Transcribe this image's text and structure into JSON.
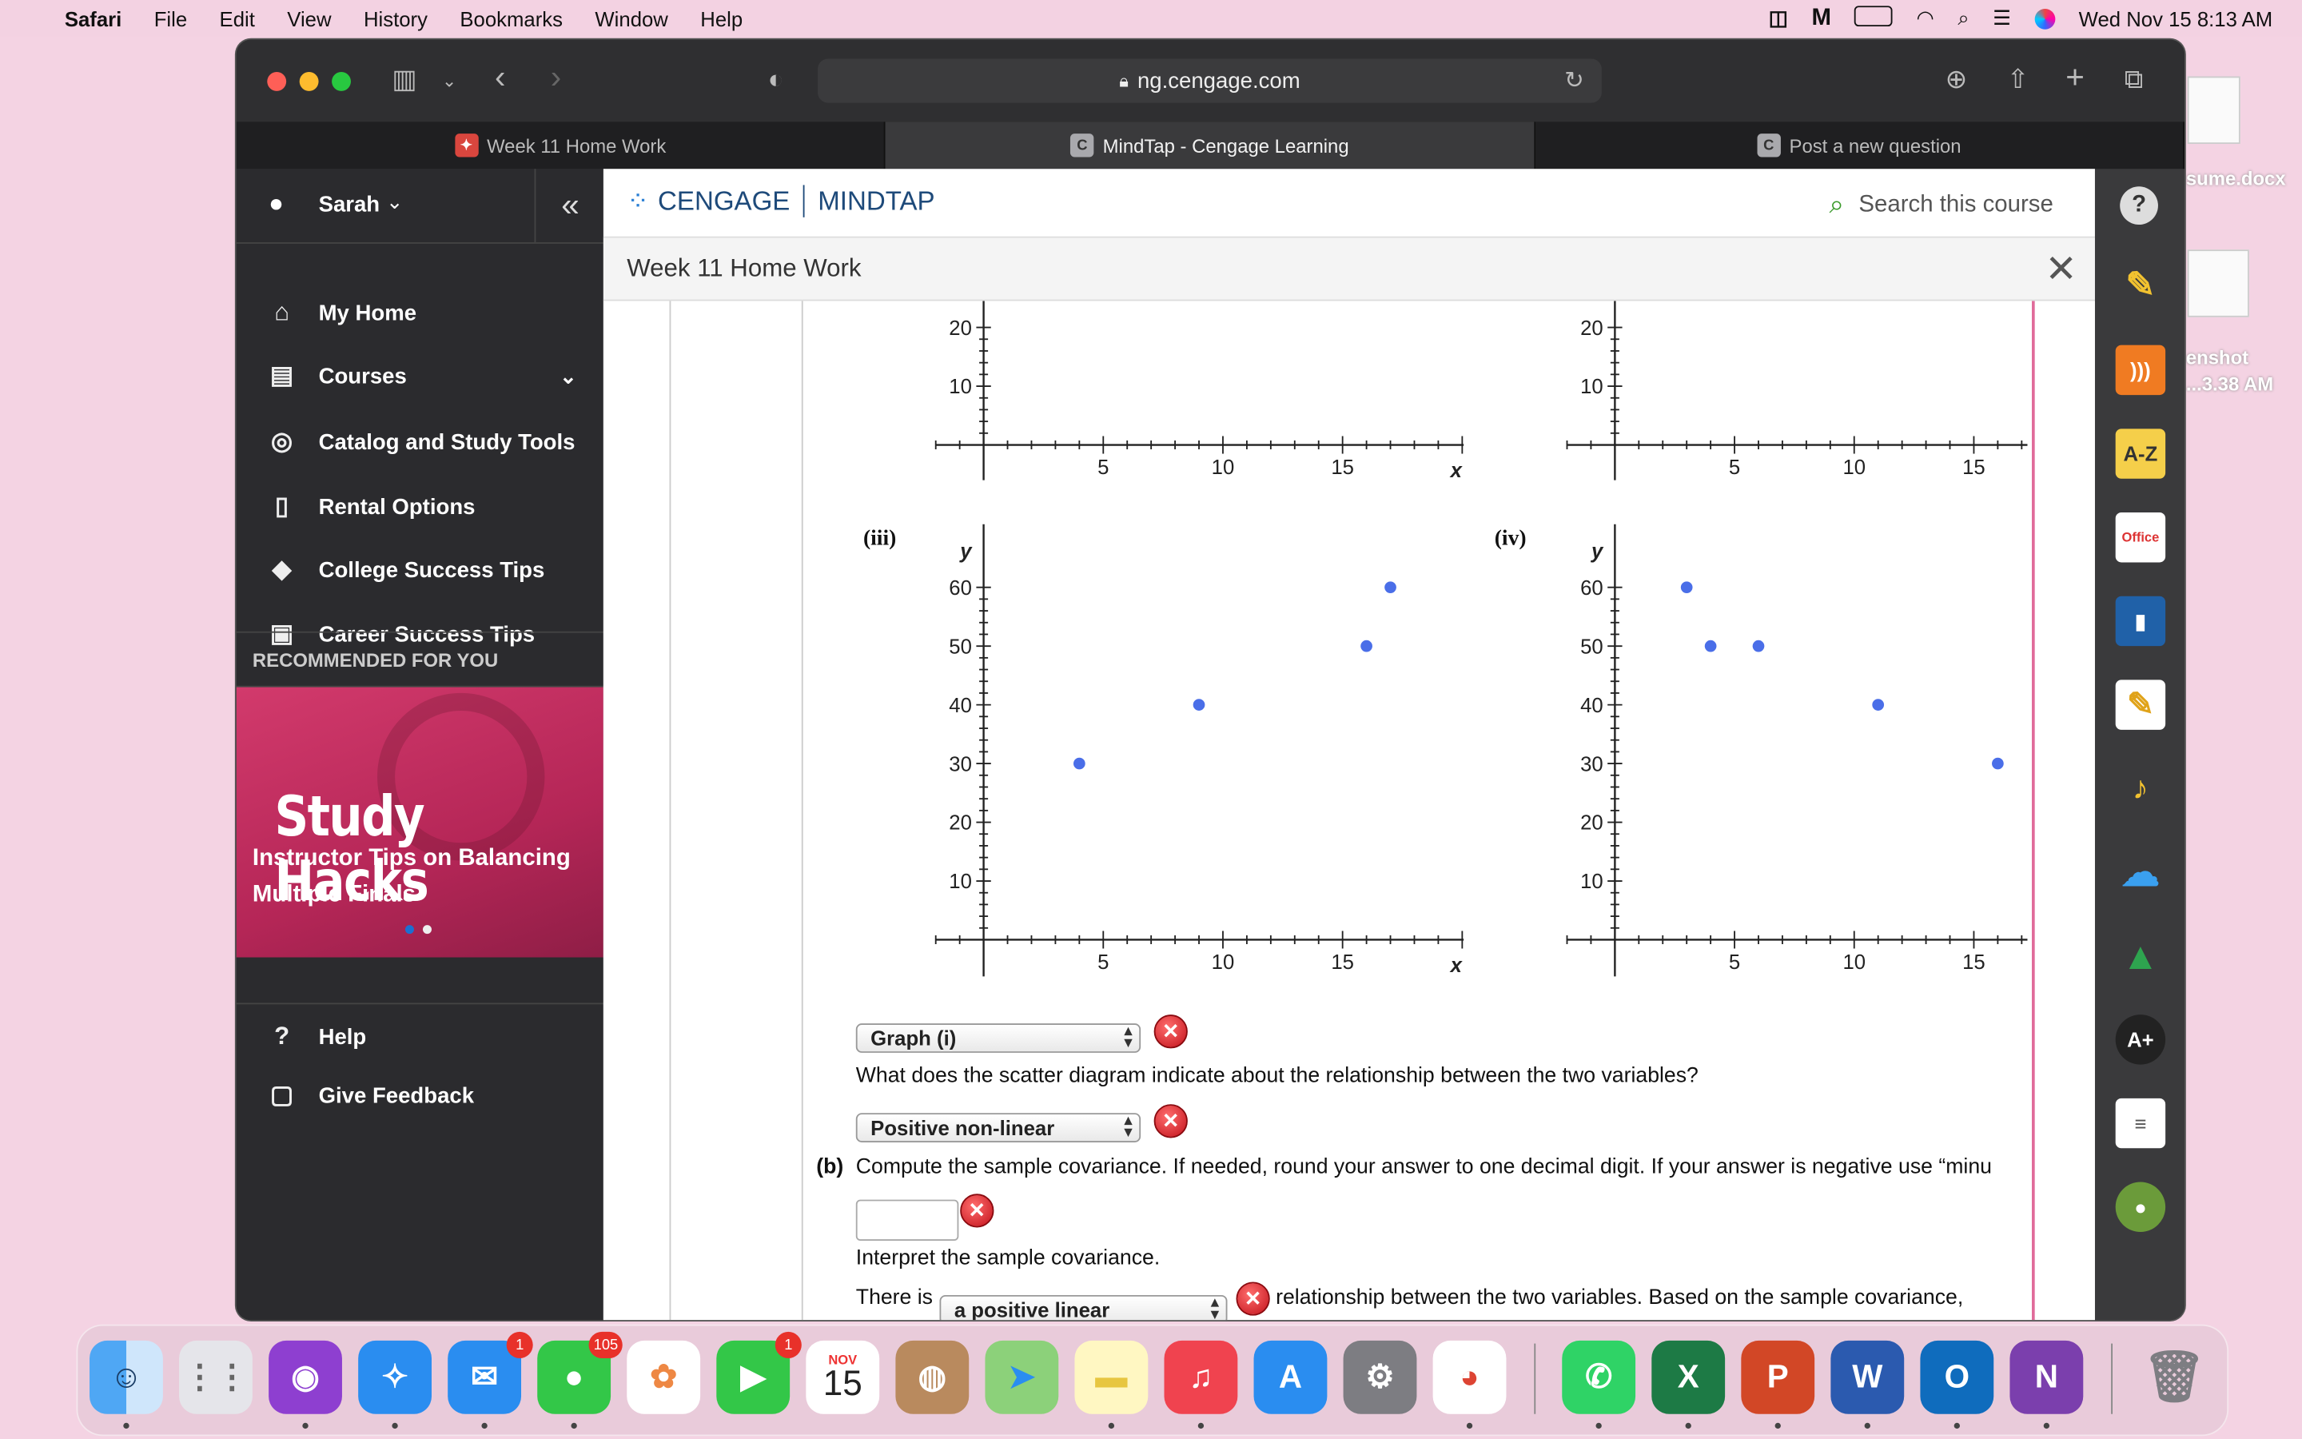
{
  "menubar": {
    "app": "Safari",
    "items": [
      "File",
      "Edit",
      "View",
      "History",
      "Bookmarks",
      "Window",
      "Help"
    ],
    "datetime": "Wed Nov 15  8:13 AM"
  },
  "desktop": {
    "file1_label": "sume.docx",
    "file2_label_a": "enshot",
    "file2_label_b": "...3.38 AM"
  },
  "browser": {
    "url": "ng.cengage.com",
    "tabs": [
      {
        "label": "Week 11 Home Work",
        "active": false
      },
      {
        "label": "MindTap - Cengage Learning",
        "active": true
      },
      {
        "label": "Post a new question",
        "active": false
      }
    ]
  },
  "sidebar": {
    "user": "Sarah",
    "items": [
      {
        "label": "My Home",
        "icon": "home-icon"
      },
      {
        "label": "Courses",
        "icon": "book-icon"
      },
      {
        "label": "Catalog and Study Tools",
        "icon": "compass-icon"
      },
      {
        "label": "Rental Options",
        "icon": "open-book-icon"
      },
      {
        "label": "College Success Tips",
        "icon": "graduation-cap-icon"
      },
      {
        "label": "Career Success Tips",
        "icon": "briefcase-icon"
      }
    ],
    "recommended_heading": "RECOMMENDED FOR YOU",
    "promo_title": "Study Hacks",
    "promo_subtitle": "Instructor Tips on Balancing Multiple Finals",
    "help": "Help",
    "feedback": "Give Feedback"
  },
  "header": {
    "brand_left": "CENGAGE",
    "brand_right": "MINDTAP",
    "search_placeholder": "Search this course",
    "page_title": "Week 11 Home Work"
  },
  "graphs": {
    "iii_label": "(iii)",
    "iv_label": "(iv)",
    "axis_y": "y",
    "axis_x": "x"
  },
  "chart_data": [
    {
      "type": "scatter",
      "title": "",
      "note": "top-left partial graph",
      "yticks": [
        10,
        20
      ],
      "xticks": [
        5,
        10,
        15
      ],
      "xlabel": "x",
      "x": [],
      "y": []
    },
    {
      "type": "scatter",
      "title": "",
      "note": "top-right partial graph",
      "yticks": [
        10,
        20
      ],
      "xticks": [
        5,
        10,
        15
      ],
      "x": [],
      "y": []
    },
    {
      "type": "scatter",
      "title": "(iii)",
      "xlabel": "x",
      "ylabel": "y",
      "xlim": [
        0,
        20
      ],
      "ylim": [
        0,
        65
      ],
      "xticks": [
        5,
        10,
        15
      ],
      "yticks": [
        10,
        20,
        30,
        40,
        50,
        60
      ],
      "x": [
        4,
        9,
        16,
        17
      ],
      "y": [
        30,
        40,
        50,
        60
      ]
    },
    {
      "type": "scatter",
      "title": "(iv)",
      "ylabel": "y",
      "xlim": [
        0,
        17
      ],
      "ylim": [
        0,
        65
      ],
      "xticks": [
        5,
        10,
        15
      ],
      "yticks": [
        10,
        20,
        30,
        40,
        50,
        60
      ],
      "x": [
        3,
        4,
        6,
        11,
        16
      ],
      "y": [
        60,
        50,
        50,
        40,
        30
      ]
    }
  ],
  "question": {
    "graph_select": "Graph (i)",
    "q_scatter": "What does the scatter diagram indicate about the relationship between the two variables?",
    "relationship_select": "Positive non-linear",
    "part_b_label": "(b)",
    "part_b_text": "Compute the sample covariance. If needed, round your answer to one decimal digit. If your answer is negative use “minu",
    "covariance_value": "",
    "interpret": "Interpret the sample covariance.",
    "there_is": "There is",
    "relationship2_select": "a positive linear",
    "after_select": "relationship between the two variables. Based on the sample covariance,"
  },
  "dock": {
    "mail_badge": "1",
    "messages_badge": "105",
    "facetime_badge": "1",
    "calendar_month": "NOV",
    "calendar_day": "15"
  }
}
